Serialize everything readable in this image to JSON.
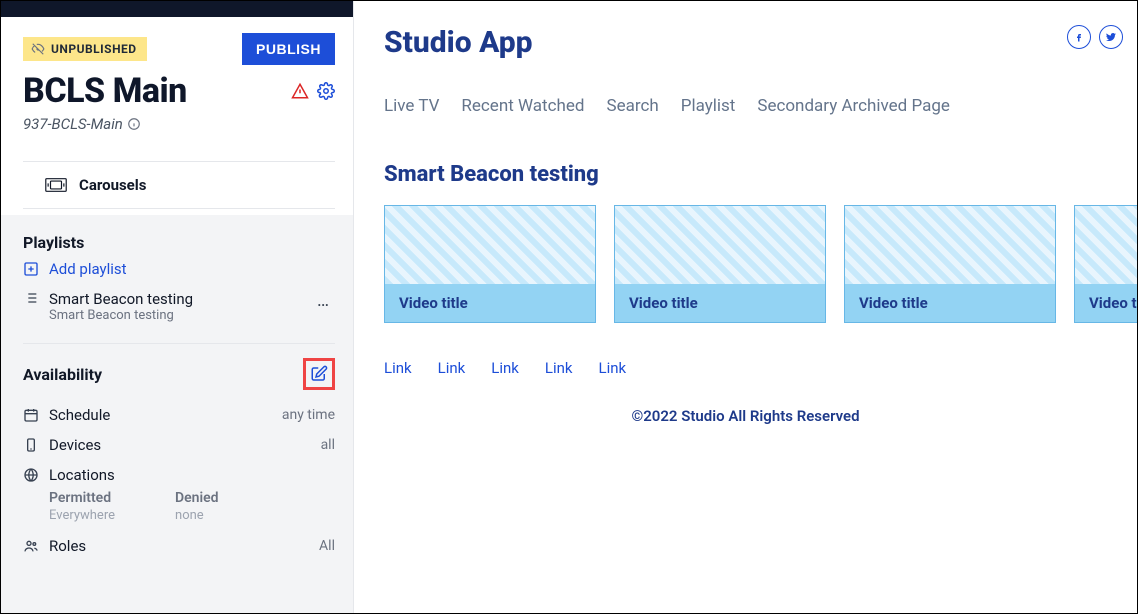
{
  "sidebar": {
    "status_badge": "UNPUBLISHED",
    "publish_btn": "PUBLISH",
    "title": "BCLS Main",
    "id_line": "937-BCLS-Main",
    "carousels_label": "Carousels",
    "playlists_title": "Playlists",
    "add_playlist": "Add playlist",
    "playlist_item": {
      "title": "Smart Beacon testing",
      "subtitle": "Smart Beacon testing"
    },
    "availability": {
      "title": "Availability",
      "schedule": {
        "label": "Schedule",
        "value": "any time"
      },
      "devices": {
        "label": "Devices",
        "value": "all"
      },
      "locations": {
        "label": "Locations",
        "permitted_label": "Permitted",
        "permitted_value": "Everywhere",
        "denied_label": "Denied",
        "denied_value": "none"
      },
      "roles": {
        "label": "Roles",
        "value": "All"
      }
    }
  },
  "main": {
    "app_title": "Studio App",
    "nav": [
      "Live TV",
      "Recent Watched",
      "Search",
      "Playlist",
      "Secondary Archived Page"
    ],
    "section_title": "Smart Beacon testing",
    "card_caption": "Video title",
    "links": [
      "Link",
      "Link",
      "Link",
      "Link",
      "Link"
    ],
    "footer": "©2022 Studio All Rights Reserved"
  }
}
